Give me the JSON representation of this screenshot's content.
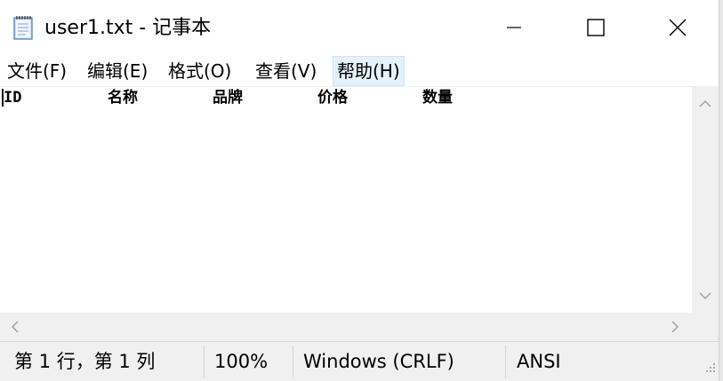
{
  "window": {
    "title": "user1.txt - 记事本",
    "app_icon": "notepad-icon",
    "controls": {
      "minimize": "minimize-icon",
      "maximize": "maximize-icon",
      "close": "close-icon"
    }
  },
  "menu": {
    "items": [
      {
        "label": "文件(F)",
        "active": false
      },
      {
        "label": "编辑(E)",
        "active": false
      },
      {
        "label": "格式(O)",
        "active": false
      },
      {
        "label": "查看(V)",
        "active": false
      },
      {
        "label": "帮助(H)",
        "active": true
      }
    ]
  },
  "editor": {
    "columns": [
      "ID",
      "名称",
      "品牌",
      "价格",
      "数量"
    ]
  },
  "scrollbars": {
    "up": "chevron-up-icon",
    "down": "chevron-down-icon",
    "left": "chevron-left-icon",
    "right": "chevron-right-icon"
  },
  "status": {
    "position": "第 1 行，第 1 列",
    "zoom": "100%",
    "line_ending": "Windows (CRLF)",
    "encoding": "ANSI"
  },
  "colors": {
    "menu_active_bg": "#e5f1fb",
    "chrome_bg": "#f0f0f0"
  }
}
